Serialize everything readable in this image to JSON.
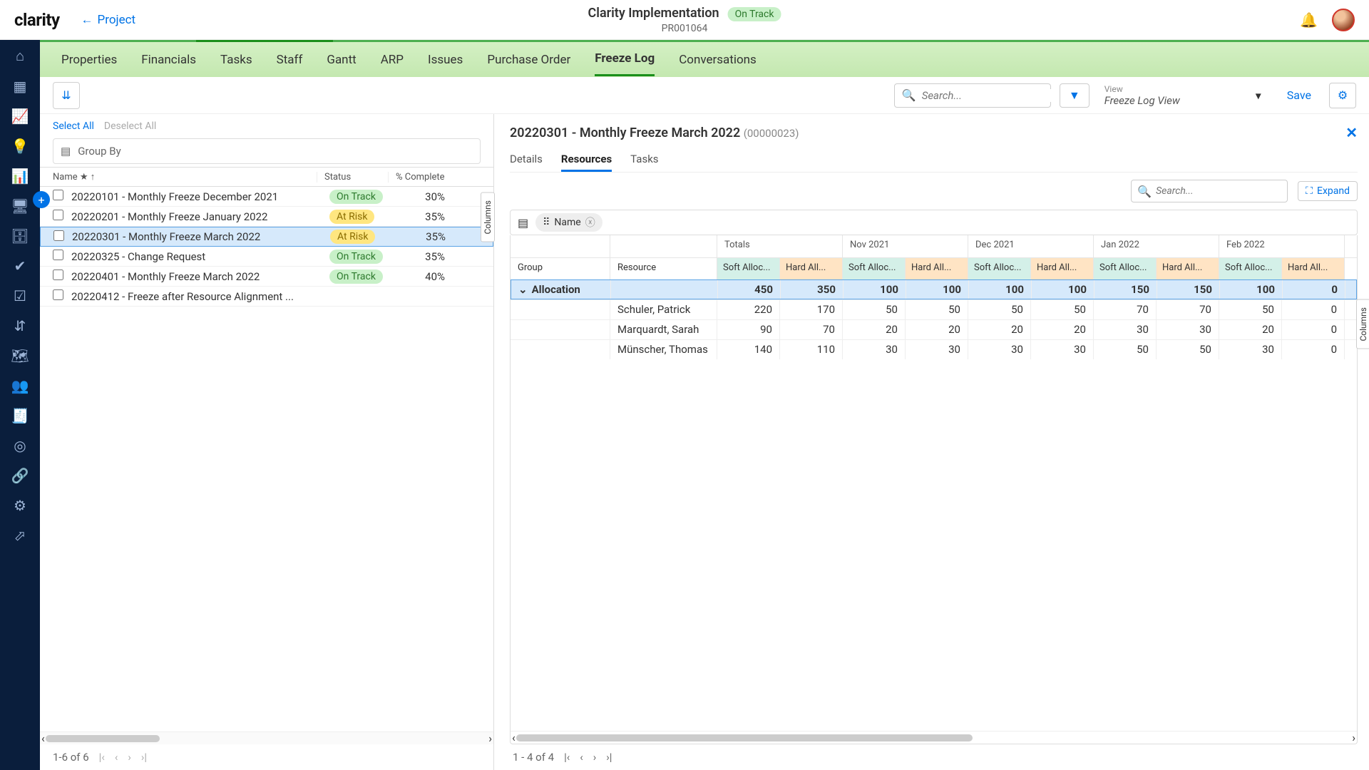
{
  "header": {
    "logo": "clarity",
    "back": "Project",
    "title": "Clarity Implementation",
    "status": "On Track",
    "code": "PR001064"
  },
  "tabs": [
    "Properties",
    "Financials",
    "Tasks",
    "Staff",
    "Gantt",
    "ARP",
    "Issues",
    "Purchase Order",
    "Freeze Log",
    "Conversations"
  ],
  "active_tab": "Freeze Log",
  "toolbar": {
    "search_ph": "Search...",
    "view_label": "View",
    "view_value": "Freeze Log View",
    "save": "Save"
  },
  "left": {
    "select_all": "Select All",
    "deselect_all": "Deselect All",
    "group_by": "Group By",
    "cols": {
      "name": "Name",
      "status": "Status",
      "pct": "% Complete"
    },
    "columns_tab": "Columns",
    "rows": [
      {
        "name": "20220101 - Monthly Freeze December 2021",
        "status": "On Track",
        "statusCls": "green",
        "pct": "30%",
        "sel": false
      },
      {
        "name": "20220201 - Monthly Freeze January 2022",
        "status": "At Risk",
        "statusCls": "yellow",
        "pct": "35%",
        "sel": false
      },
      {
        "name": "20220301 - Monthly Freeze March 2022",
        "status": "At Risk",
        "statusCls": "yellow",
        "pct": "35%",
        "sel": true
      },
      {
        "name": "20220325 - Change Request",
        "status": "On Track",
        "statusCls": "green",
        "pct": "35%",
        "sel": false
      },
      {
        "name": "20220401 - Monthly Freeze March 2022",
        "status": "On Track",
        "statusCls": "green",
        "pct": "40%",
        "sel": false
      },
      {
        "name": "20220412 - Freeze after Resource Alignment ...",
        "status": "",
        "statusCls": "",
        "pct": "",
        "sel": false
      }
    ],
    "pager": "1-6 of 6"
  },
  "right": {
    "title": "20220301 - Monthly Freeze March 2022",
    "subtitle": "(00000023)",
    "tabs": [
      "Details",
      "Resources",
      "Tasks"
    ],
    "active_tab": "Resources",
    "search_ph": "Search...",
    "expand": "Expand",
    "chip": "Name",
    "columns_tab": "Columns",
    "head": {
      "group": "Group",
      "resource": "Resource",
      "totals": "Totals",
      "months": [
        "Nov 2021",
        "Dec 2021",
        "Jan 2022",
        "Feb 2022"
      ],
      "soft": "Soft Alloc...",
      "hard": "Hard All..."
    },
    "rows": [
      {
        "group": "Allocation",
        "resource": "",
        "vals": [
          "450",
          "350",
          "100",
          "100",
          "100",
          "100",
          "150",
          "150",
          "100",
          "0"
        ],
        "total": true
      },
      {
        "group": "",
        "resource": "Schuler, Patrick",
        "vals": [
          "220",
          "170",
          "50",
          "50",
          "50",
          "50",
          "70",
          "70",
          "50",
          "0"
        ]
      },
      {
        "group": "",
        "resource": "Marquardt, Sarah",
        "vals": [
          "90",
          "70",
          "20",
          "20",
          "20",
          "20",
          "30",
          "30",
          "20",
          "0"
        ]
      },
      {
        "group": "",
        "resource": "Münscher, Thomas",
        "vals": [
          "140",
          "110",
          "30",
          "30",
          "30",
          "30",
          "50",
          "50",
          "30",
          "0"
        ]
      }
    ],
    "pager": "1 - 4 of 4"
  },
  "nav_icons": [
    "home-icon",
    "grid-icon",
    "chart-icon",
    "idea-icon",
    "bars-icon",
    "monitor-icon",
    "db-icon",
    "check-icon",
    "checklist-icon",
    "hierarchy-icon",
    "map-icon",
    "people-icon",
    "doc-icon",
    "target-icon",
    "link-icon",
    "cog-icon",
    "export-icon"
  ]
}
